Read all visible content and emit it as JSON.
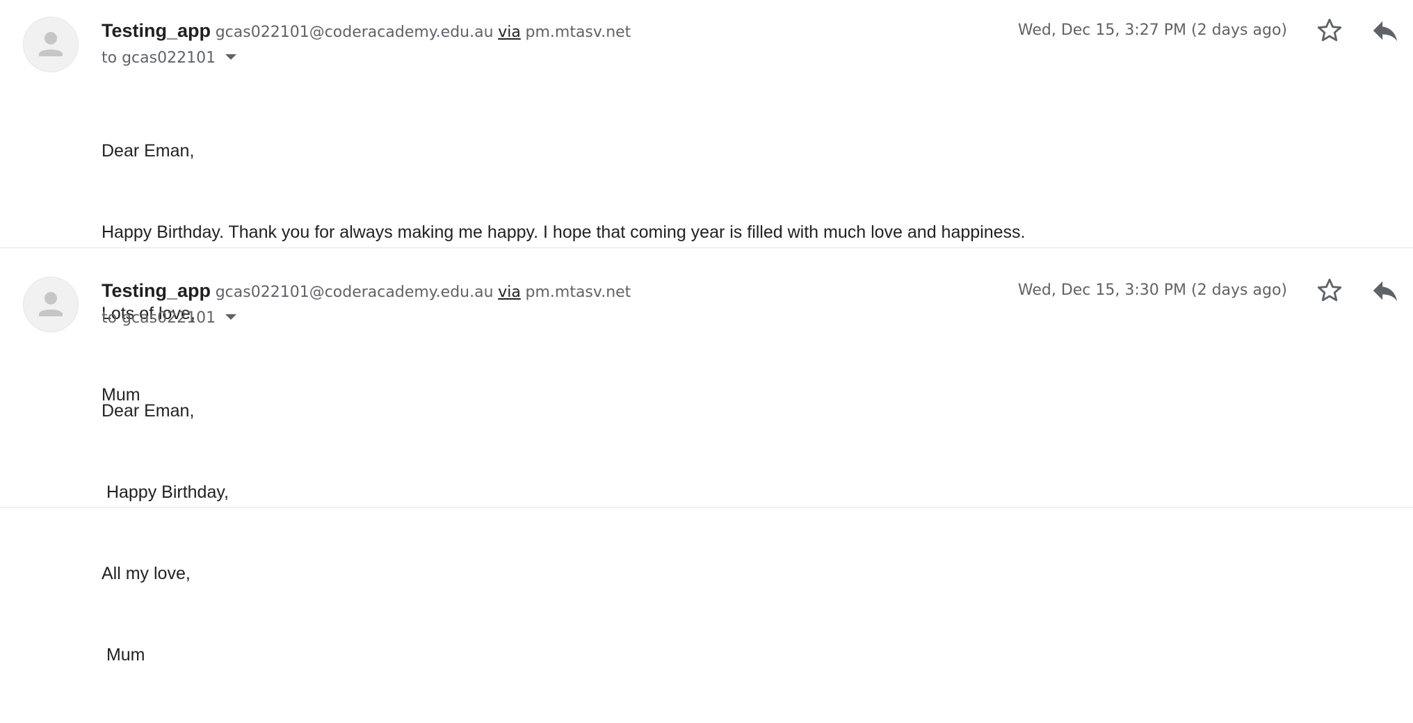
{
  "messages": [
    {
      "sender_name": "Testing_app",
      "sender_email": "gcas022101@coderacademy.edu.au",
      "via_label": "via",
      "via_host": "pm.mtasv.net",
      "to_label": "to gcas022101",
      "date": "Wed, Dec 15, 3:27 PM (2 days ago)",
      "body_lines": [
        "Dear Eman,",
        "Happy Birthday. Thank you for always making me happy. I hope that coming year is filled with much love and happiness.",
        "Lots of love,",
        "Mum"
      ]
    },
    {
      "sender_name": "Testing_app",
      "sender_email": "gcas022101@coderacademy.edu.au",
      "via_label": "via",
      "via_host": "pm.mtasv.net",
      "to_label": "to gcas022101",
      "date": "Wed, Dec 15, 3:30 PM (2 days ago)",
      "body_lines": [
        "Dear Eman,",
        " Happy Birthday,",
        "All my love,",
        " Mum"
      ]
    }
  ],
  "icons": {
    "avatar": "person-icon",
    "star": "star-outline-icon",
    "reply": "reply-icon",
    "caret": "caret-down-icon"
  },
  "colors": {
    "text_primary": "#222222",
    "text_secondary": "#5f6368",
    "avatar_bg": "#f1f1f1",
    "avatar_glyph": "#c6c6c6",
    "divider": "#e3e3e3"
  }
}
